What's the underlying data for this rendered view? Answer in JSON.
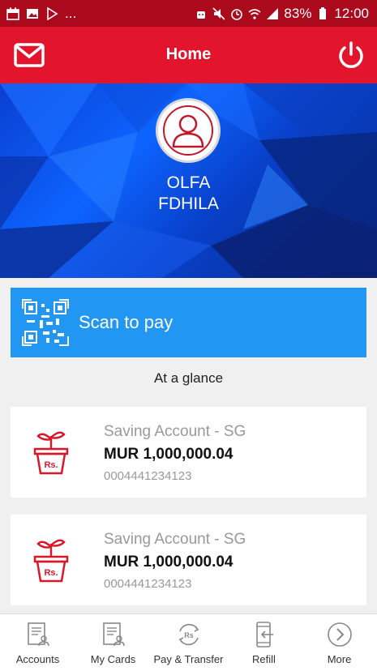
{
  "status_bar": {
    "battery": "83%",
    "time": "12:00",
    "more": "..."
  },
  "header": {
    "title": "Home",
    "accent_color": "#e2152c"
  },
  "profile": {
    "first_name": "OLFA",
    "last_name": "FDHILA"
  },
  "scan": {
    "label": "Scan to pay",
    "color": "#2196f3"
  },
  "glance_label": "At a glance",
  "accounts": [
    {
      "name": "Saving Account - SG",
      "balance": "MUR 1,000,000.04",
      "number": "0004441234123",
      "icon": "plant-pot-rupee-icon"
    },
    {
      "name": "Saving Account - SG",
      "balance": "MUR 1,000,000.04",
      "number": "0004441234123",
      "icon": "plant-pot-rupee-icon"
    }
  ],
  "bottom_nav": [
    {
      "label": "Accounts",
      "icon": "accounts-icon"
    },
    {
      "label": "My Cards",
      "icon": "cards-icon"
    },
    {
      "label": "Pay & Transfer",
      "icon": "rupee-transfer-icon"
    },
    {
      "label": "Refill",
      "icon": "refill-phone-icon"
    },
    {
      "label": "More",
      "icon": "chevron-right-circle-icon"
    }
  ]
}
